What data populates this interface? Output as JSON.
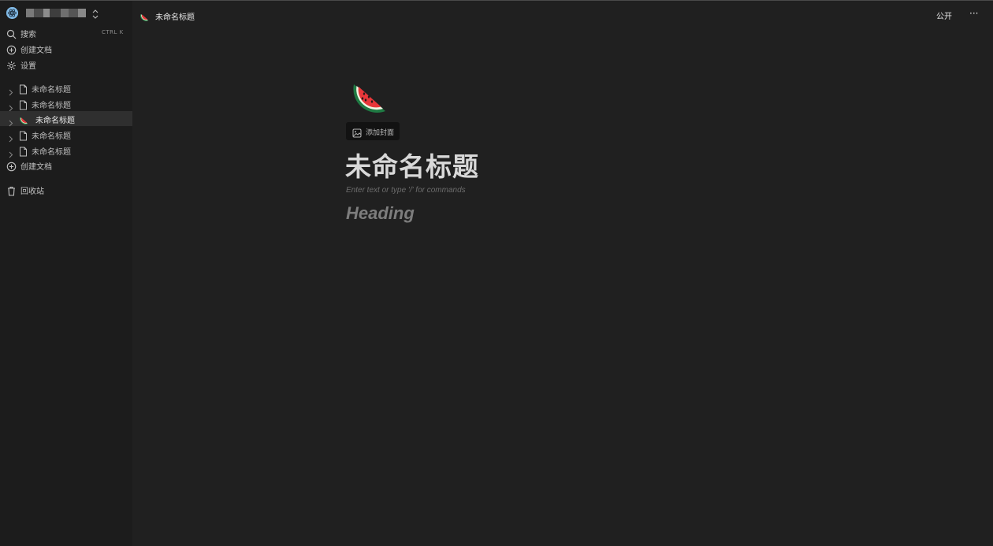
{
  "workspace": {
    "logo_icon": "react-logo-icon",
    "switch_icon": "chevron-up-down-icon"
  },
  "nav": [
    {
      "id": "search",
      "label": "搜索",
      "shortcut": "CTRL K",
      "icon": "search-icon"
    },
    {
      "id": "create",
      "label": "创建文档",
      "icon": "plus-circle-icon"
    },
    {
      "id": "settings",
      "label": "设置",
      "icon": "gear-icon"
    }
  ],
  "tree": [
    {
      "label": "未命名标题",
      "icon": "document-icon",
      "active": false
    },
    {
      "label": "未命名标题",
      "icon": "document-icon",
      "active": false
    },
    {
      "label": "未命名标题",
      "icon": "watermelon-icon",
      "active": true
    },
    {
      "label": "未命名标题",
      "icon": "document-icon",
      "active": false
    },
    {
      "label": "未命名标题",
      "icon": "document-icon",
      "active": false
    }
  ],
  "tree_create_label": "创建文档",
  "trash_label": "回收站",
  "topbar": {
    "breadcrumb": "未命名标题",
    "share_label": "公开",
    "more_label": "···"
  },
  "page": {
    "icon": "watermelon-icon",
    "add_cover_label": "添加封面",
    "title": "未命名标题",
    "placeholder": "Enter text or type '/' for commands",
    "heading": "Heading"
  },
  "colors": {
    "background": "#202020",
    "sidebar": "#1c1c1c",
    "active_row": "#2f2f2f"
  }
}
